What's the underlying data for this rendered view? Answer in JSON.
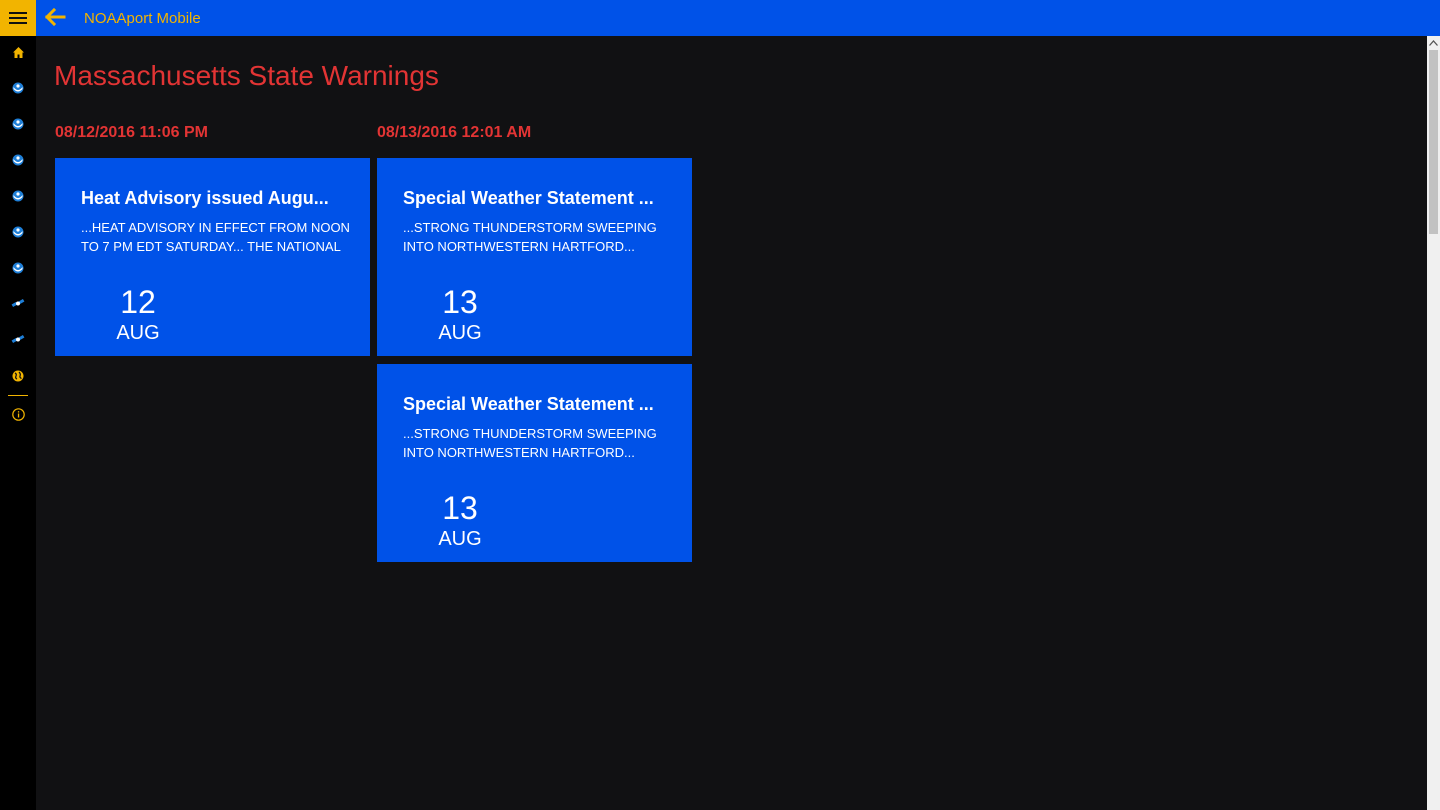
{
  "app": {
    "title": "NOAAport Mobile"
  },
  "colors": {
    "accent": "#f2b400",
    "brand": "#0052e8",
    "heading": "#e23434",
    "background": "#111113"
  },
  "sidebar": {
    "items": [
      {
        "icon": "home-icon"
      },
      {
        "icon": "noaa-logo-icon"
      },
      {
        "icon": "noaa-logo-icon"
      },
      {
        "icon": "noaa-logo-icon"
      },
      {
        "icon": "noaa-logo-icon"
      },
      {
        "icon": "noaa-logo-icon"
      },
      {
        "icon": "noaa-logo-icon"
      },
      {
        "icon": "satellite-icon"
      },
      {
        "icon": "satellite-icon"
      },
      {
        "icon": "globe-icon"
      },
      {
        "icon": "info-icon"
      }
    ]
  },
  "main": {
    "title": "Massachusetts State Warnings",
    "groups": [
      {
        "header": "08/12/2016 11:06 PM",
        "cards": [
          {
            "title": "Heat Advisory issued Augu...",
            "body": "...HEAT ADVISORY IN EFFECT FROM NOON TO 7 PM EDT SATURDAY... THE NATIONAL",
            "day": "12",
            "month": "AUG"
          }
        ]
      },
      {
        "header": "08/13/2016 12:01 AM",
        "cards": [
          {
            "title": "Special Weather Statement ...",
            "body": "...STRONG THUNDERSTORM SWEEPING INTO NORTHWESTERN HARTFORD...",
            "day": "13",
            "month": "AUG"
          },
          {
            "title": "Special Weather Statement ...",
            "body": "...STRONG THUNDERSTORM SWEEPING INTO NORTHWESTERN HARTFORD...",
            "day": "13",
            "month": "AUG"
          }
        ]
      }
    ]
  }
}
